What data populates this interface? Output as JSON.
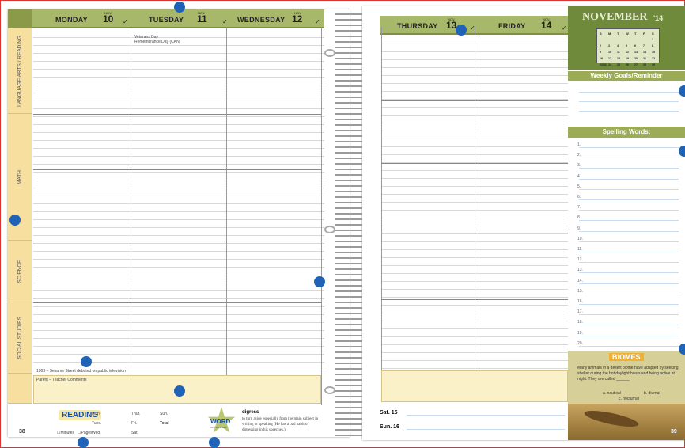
{
  "left_page": {
    "days": [
      {
        "name": "MONDAY",
        "nov": "NOV.",
        "num": "10"
      },
      {
        "name": "TUESDAY",
        "nov": "NOV.",
        "num": "11"
      },
      {
        "name": "WEDNESDAY",
        "nov": "NOV.",
        "num": "12"
      }
    ],
    "subjects": [
      "LANGUAGE ARTS / READING",
      "MATH",
      "SCIENCE",
      "SOCIAL STUDIES"
    ],
    "tuesday_notes": [
      "Veterans Day",
      "Remembrance Day (CAN)"
    ],
    "monday_note": "1903 – Sesame Street debuted on public television",
    "parent_label": "Parent – Teacher Comments",
    "page_number": "38",
    "reading_label": "READING",
    "minutes_label": "Minutes",
    "pages_label": "Pages",
    "reading_days": [
      "Mon.",
      "Tues.",
      "Wed.",
      "Thur.",
      "Fri.",
      "Sat.",
      "Sun."
    ],
    "total_label": "Total",
    "word_label": "WORD",
    "word_sub": "OF THE WEEK",
    "word": "digress",
    "word_def": "to turn aside especially from the main subject in writing or speaking (He has a bad habit of digressing in his speeches.)"
  },
  "right_page": {
    "days": [
      {
        "name": "THURSDAY",
        "nov": "NOV.",
        "num": "13"
      },
      {
        "name": "FRIDAY",
        "nov": "NOV.",
        "num": "14"
      }
    ],
    "weekend": [
      "Sat. 15",
      "Sun. 16"
    ],
    "side": {
      "month": "NOVEMBER",
      "year": "'14",
      "cal_head": [
        "S",
        "M",
        "T",
        "W",
        "T",
        "F",
        "S"
      ],
      "cal_rows": [
        [
          "",
          "",
          "",
          "",
          "",
          "",
          "1"
        ],
        [
          "2",
          "3",
          "4",
          "5",
          "6",
          "7",
          "8"
        ],
        [
          "9",
          "10",
          "11",
          "12",
          "13",
          "14",
          "15"
        ],
        [
          "16",
          "17",
          "18",
          "19",
          "20",
          "21",
          "22"
        ],
        [
          "23/30",
          "24",
          "25",
          "26",
          "27",
          "28",
          "29"
        ]
      ],
      "goals_label": "Weekly Goals/Reminder",
      "spelling_label": "Spelling Words:",
      "spelling_nums": [
        "1.",
        "2.",
        "3.",
        "4.",
        "5.",
        "6.",
        "7.",
        "8.",
        "9.",
        "10.",
        "11.",
        "12.",
        "13.",
        "14.",
        "15.",
        "16.",
        "17.",
        "18.",
        "19.",
        "20."
      ],
      "biomes_label": "BIOMES",
      "biomes_text": "Many animals in a desert biome have adapted by seeking shelter during the hot daylight hours and being active at night. They are called ______.",
      "biomes_options": [
        "a. nautical",
        "b. diurnal",
        "c. nocturnal"
      ],
      "page_number": "39"
    }
  }
}
